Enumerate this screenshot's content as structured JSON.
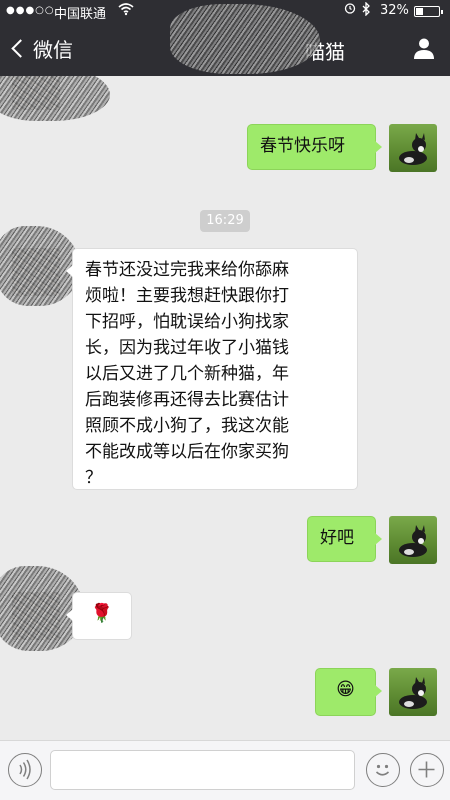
{
  "status_bar": {
    "signal": "●●●○○",
    "carrier": "中国联通",
    "battery_percent": "32%",
    "battery_level": 0.32
  },
  "nav": {
    "back_label": "微信",
    "title": "喵猫"
  },
  "chat": {
    "messages": [
      {
        "side": "right",
        "text": "春节快乐呀"
      },
      {
        "side": "left",
        "text_lines": [
          "春节还没过完我来给你舔麻",
          "烦啦！主要我想赶快跟你打",
          "下招呼，怕耽误给小狗找家",
          "长，因为我过年收了小猫钱",
          "以后又进了几个新种猫，年",
          "后跑装修再还得去比赛估计",
          "照顾不成小狗了，我这次能",
          "不能改成等以后在你家买狗",
          "？"
        ]
      },
      {
        "side": "right",
        "text": "好吧"
      },
      {
        "side": "left",
        "emoji": "🌹"
      },
      {
        "side": "right",
        "emoji": "😁"
      }
    ],
    "timestamp": "16:29"
  },
  "input": {
    "placeholder": ""
  },
  "colors": {
    "nav_bg": "#2e2e33",
    "chat_bg": "#ebebeb",
    "sent_bubble": "#9eea6a",
    "received_bubble": "#ffffff"
  }
}
